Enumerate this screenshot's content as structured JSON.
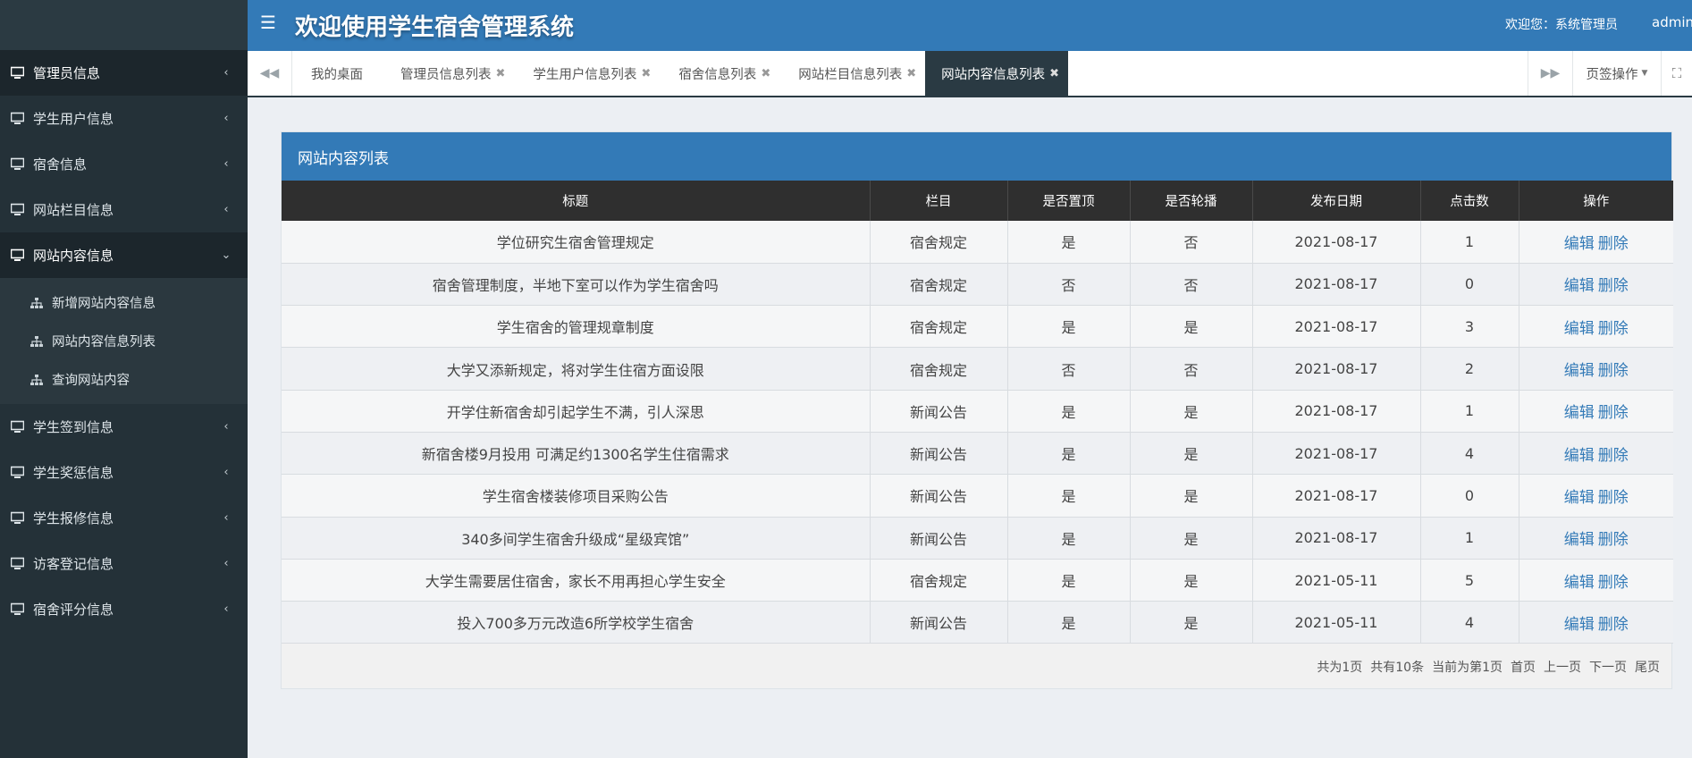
{
  "header": {
    "title": "欢迎使用学生宿舍管理系统",
    "welcome": "欢迎您：系统管理员",
    "user": "admin"
  },
  "sidebar": {
    "items": [
      {
        "label": "管理员信息"
      },
      {
        "label": "学生用户信息"
      },
      {
        "label": "宿舍信息"
      },
      {
        "label": "网站栏目信息"
      },
      {
        "label": "网站内容信息"
      },
      {
        "label": "学生签到信息"
      },
      {
        "label": "学生奖惩信息"
      },
      {
        "label": "学生报修信息"
      },
      {
        "label": "访客登记信息"
      },
      {
        "label": "宿舍评分信息"
      }
    ],
    "submenu": [
      {
        "label": "新增网站内容信息"
      },
      {
        "label": "网站内容信息列表"
      },
      {
        "label": "查询网站内容"
      }
    ]
  },
  "tabs": {
    "items": [
      {
        "label": "我的桌面"
      },
      {
        "label": "管理员信息列表"
      },
      {
        "label": "学生用户信息列表"
      },
      {
        "label": "宿舍信息列表"
      },
      {
        "label": "网站栏目信息列表"
      },
      {
        "label": "网站内容信息列表"
      }
    ],
    "ops_label": "页签操作"
  },
  "panel": {
    "title": "网站内容列表",
    "columns": [
      "标题",
      "栏目",
      "是否置顶",
      "是否轮播",
      "发布日期",
      "点击数",
      "操作"
    ],
    "edit_label": "编辑",
    "delete_label": "删除",
    "rows": [
      {
        "title": "学位研究生宿舍管理规定",
        "category": "宿舍规定",
        "top": "是",
        "carousel": "否",
        "date": "2021-08-17",
        "clicks": "1"
      },
      {
        "title": "宿舍管理制度，半地下室可以作为学生宿舍吗",
        "category": "宿舍规定",
        "top": "否",
        "carousel": "否",
        "date": "2021-08-17",
        "clicks": "0"
      },
      {
        "title": "学生宿舍的管理规章制度",
        "category": "宿舍规定",
        "top": "是",
        "carousel": "是",
        "date": "2021-08-17",
        "clicks": "3"
      },
      {
        "title": "大学又添新规定，将对学生住宿方面设限",
        "category": "宿舍规定",
        "top": "否",
        "carousel": "否",
        "date": "2021-08-17",
        "clicks": "2"
      },
      {
        "title": "开学住新宿舍却引起学生不满，引人深思",
        "category": "新闻公告",
        "top": "是",
        "carousel": "是",
        "date": "2021-08-17",
        "clicks": "1"
      },
      {
        "title": "新宿舍楼9月投用 可满足约1300名学生住宿需求",
        "category": "新闻公告",
        "top": "是",
        "carousel": "是",
        "date": "2021-08-17",
        "clicks": "4"
      },
      {
        "title": "学生宿舍楼装修项目采购公告",
        "category": "新闻公告",
        "top": "是",
        "carousel": "是",
        "date": "2021-08-17",
        "clicks": "0"
      },
      {
        "title": "340多间学生宿舍升级成“星级宾馆”",
        "category": "新闻公告",
        "top": "是",
        "carousel": "是",
        "date": "2021-08-17",
        "clicks": "1"
      },
      {
        "title": "大学生需要居住宿舍，家长不用再担心学生安全",
        "category": "宿舍规定",
        "top": "是",
        "carousel": "是",
        "date": "2021-05-11",
        "clicks": "5"
      },
      {
        "title": "投入700多万元改造6所学校学生宿舍",
        "category": "新闻公告",
        "top": "是",
        "carousel": "是",
        "date": "2021-05-11",
        "clicks": "4"
      }
    ]
  },
  "pagination": {
    "total_pages": "共为1页",
    "total_records": "共有10条",
    "current": "当前为第1页",
    "first": "首页",
    "prev": "上一页",
    "next": "下一页",
    "last": "尾页"
  }
}
